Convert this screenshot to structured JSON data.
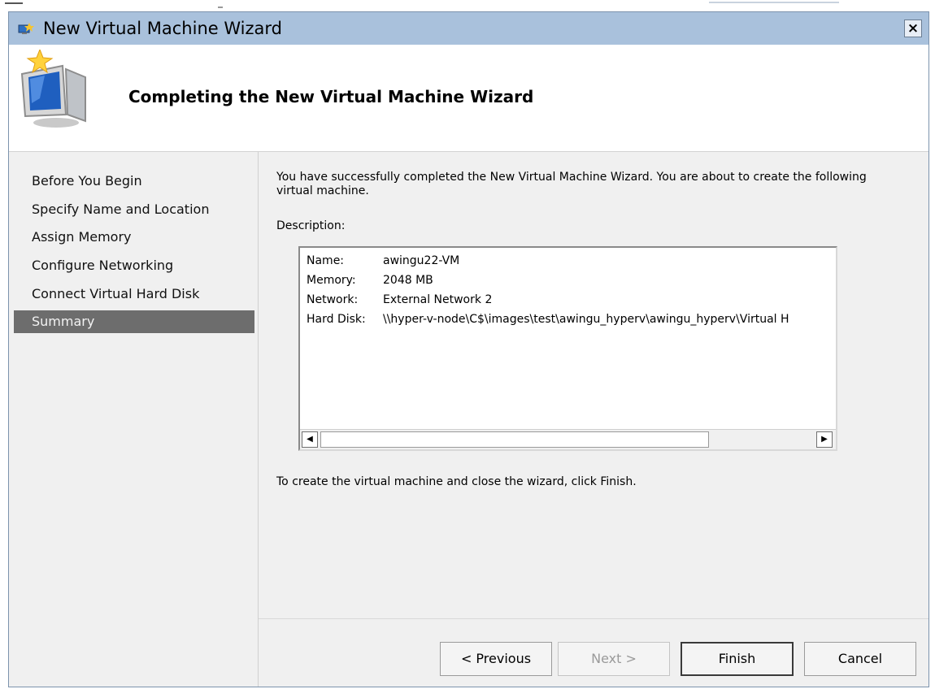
{
  "window": {
    "title": "New Virtual Machine Wizard",
    "close_label": "×"
  },
  "header": {
    "heading": "Completing the New Virtual Machine Wizard"
  },
  "sidebar": {
    "items": [
      {
        "label": "Before You Begin"
      },
      {
        "label": "Specify Name and Location"
      },
      {
        "label": "Assign Memory"
      },
      {
        "label": "Configure Networking"
      },
      {
        "label": "Connect Virtual Hard Disk"
      },
      {
        "label": "Summary",
        "selected": true
      }
    ]
  },
  "main": {
    "intro": "You have successfully completed the New Virtual Machine Wizard. You are about to create the following virtual machine.",
    "description_label": "Description:",
    "description_rows": [
      {
        "key": "Name:",
        "value": "awingu22-VM"
      },
      {
        "key": "Memory:",
        "value": "2048 MB"
      },
      {
        "key": "Network:",
        "value": "External Network 2"
      },
      {
        "key": "Hard Disk:",
        "value": "\\\\hyper-v-node\\C$\\images\\test\\awingu_hyperv\\awingu_hyperv\\Virtual H"
      }
    ],
    "scroll_left": "◀",
    "scroll_right": "▶",
    "outro": "To create the virtual machine and close the wizard, click Finish."
  },
  "buttons": {
    "previous": "< Previous",
    "next": "Next >",
    "finish": "Finish",
    "cancel": "Cancel"
  },
  "colors": {
    "titlebar": "#a9c1dc",
    "selected_nav": "#6d6d6d"
  }
}
